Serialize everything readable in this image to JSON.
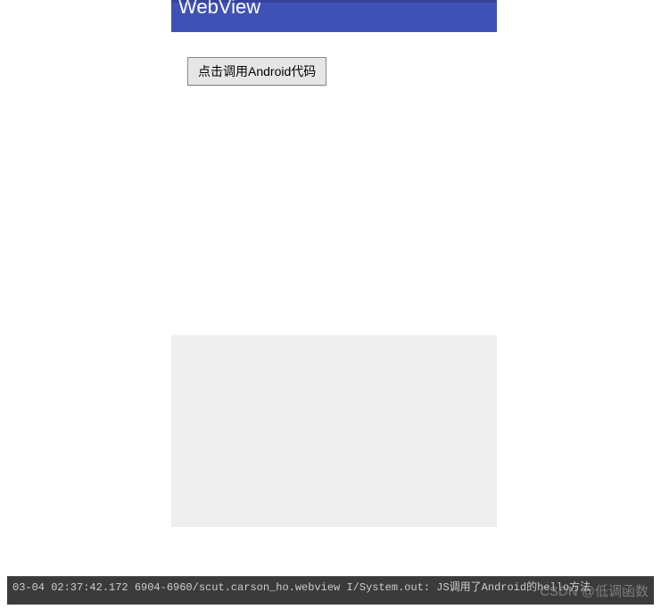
{
  "app": {
    "title": "WebView"
  },
  "webview": {
    "button_label": "点击调用Android代码"
  },
  "log": {
    "line": "03-04 02:37:42.172 6904-6960/scut.carson_ho.webview I/System.out: JS调用了Android的hello方法"
  },
  "watermark": {
    "text": "CSDN @低调函数"
  }
}
